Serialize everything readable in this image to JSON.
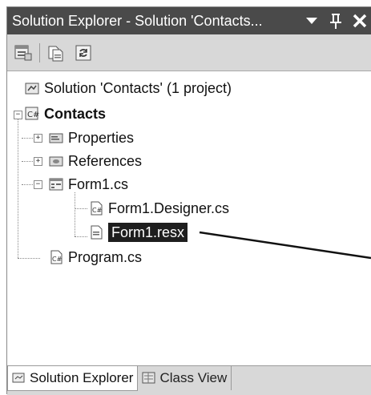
{
  "window": {
    "title": "Solution Explorer - Solution 'Contacts...",
    "dropdown_icon": "chevron-down-icon",
    "pin_icon": "pin-icon",
    "close_icon": "close-icon"
  },
  "toolbar": {
    "buttons": [
      {
        "name": "properties-icon"
      },
      {
        "name": "show-all-files-icon"
      },
      {
        "name": "refresh-icon"
      }
    ]
  },
  "tree": {
    "solution": "Solution 'Contacts' (1 project)",
    "project": "Contacts",
    "properties": "Properties",
    "references": "References",
    "form1": "Form1.cs",
    "form1_designer": "Form1.Designer.cs",
    "form1_resx": "Form1.resx",
    "program": "Program.cs",
    "expand_plus": "+",
    "expand_minus": "−"
  },
  "tabs": {
    "solution_explorer": "Solution Explorer",
    "class_view": "Class View"
  }
}
